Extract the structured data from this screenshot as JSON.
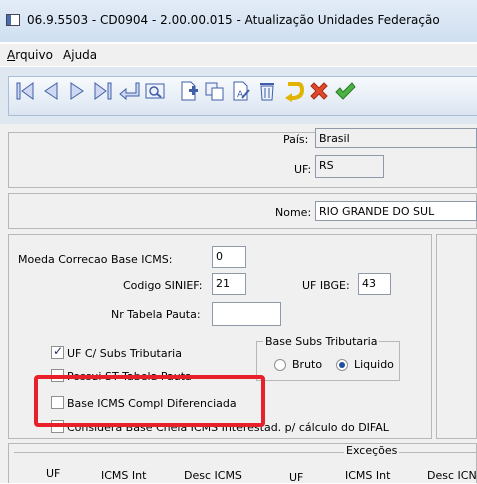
{
  "window": {
    "title": "06.9.5503 - CD0904 - 2.00.00.015 - Atualização Unidades Federação"
  },
  "menu": {
    "items": [
      {
        "first": "A",
        "rest": "rquivo"
      },
      {
        "first": "Aj",
        "rest": "uda",
        "underline_second": true
      }
    ],
    "arquivo_u": "A",
    "arquivo_rest": "rquivo",
    "ajuda_a": "A",
    "ajuda_j": "j",
    "ajuda_rest": "uda"
  },
  "toolbar": {
    "icons": [
      "first-record-icon",
      "prev-record-icon",
      "next-record-icon",
      "last-record-icon",
      "enter-icon",
      "search-icon",
      "new-record-icon",
      "copy-record-icon",
      "edit-record-icon",
      "delete-record-icon",
      "undo-icon",
      "cancel-icon",
      "confirm-icon"
    ]
  },
  "form": {
    "pais_label": "País:",
    "pais_value": "Brasil",
    "uf_label": "UF:",
    "uf_value": "RS",
    "nome_label": "Nome:",
    "nome_value": "RIO GRANDE DO SUL",
    "moeda_label": "Moeda Correcao Base ICMS:",
    "moeda_value": "0",
    "sinief_label": "Codigo SINIEF:",
    "sinief_value": "21",
    "ibge_label": "UF IBGE:",
    "ibge_value": "43",
    "pauta_label": "Nr Tabela Pauta:",
    "pauta_value": ""
  },
  "checks": {
    "subs_trib": {
      "label": "UF C/ Subs Tributaria",
      "checked": true
    },
    "possui_st": {
      "label": "Possui ST Tabela Pauta",
      "checked": false
    },
    "base_icms": {
      "label": "Base ICMS Compl Diferenciada",
      "checked": false
    },
    "considera": {
      "label": "Considera Base Cheia ICMS Interestad. p/ cálculo do DIFAL",
      "checked": false
    }
  },
  "base_subs": {
    "title": "Base Subs Tributaria",
    "bruto": "Bruto",
    "liquido": "Liquido",
    "selected": "Liquido"
  },
  "excecoes": {
    "title": "Exceções",
    "columns": [
      "UF",
      "ICMS Int",
      "Desc ICMS",
      "UF",
      "ICMS Int",
      "Desc ICN"
    ]
  }
}
